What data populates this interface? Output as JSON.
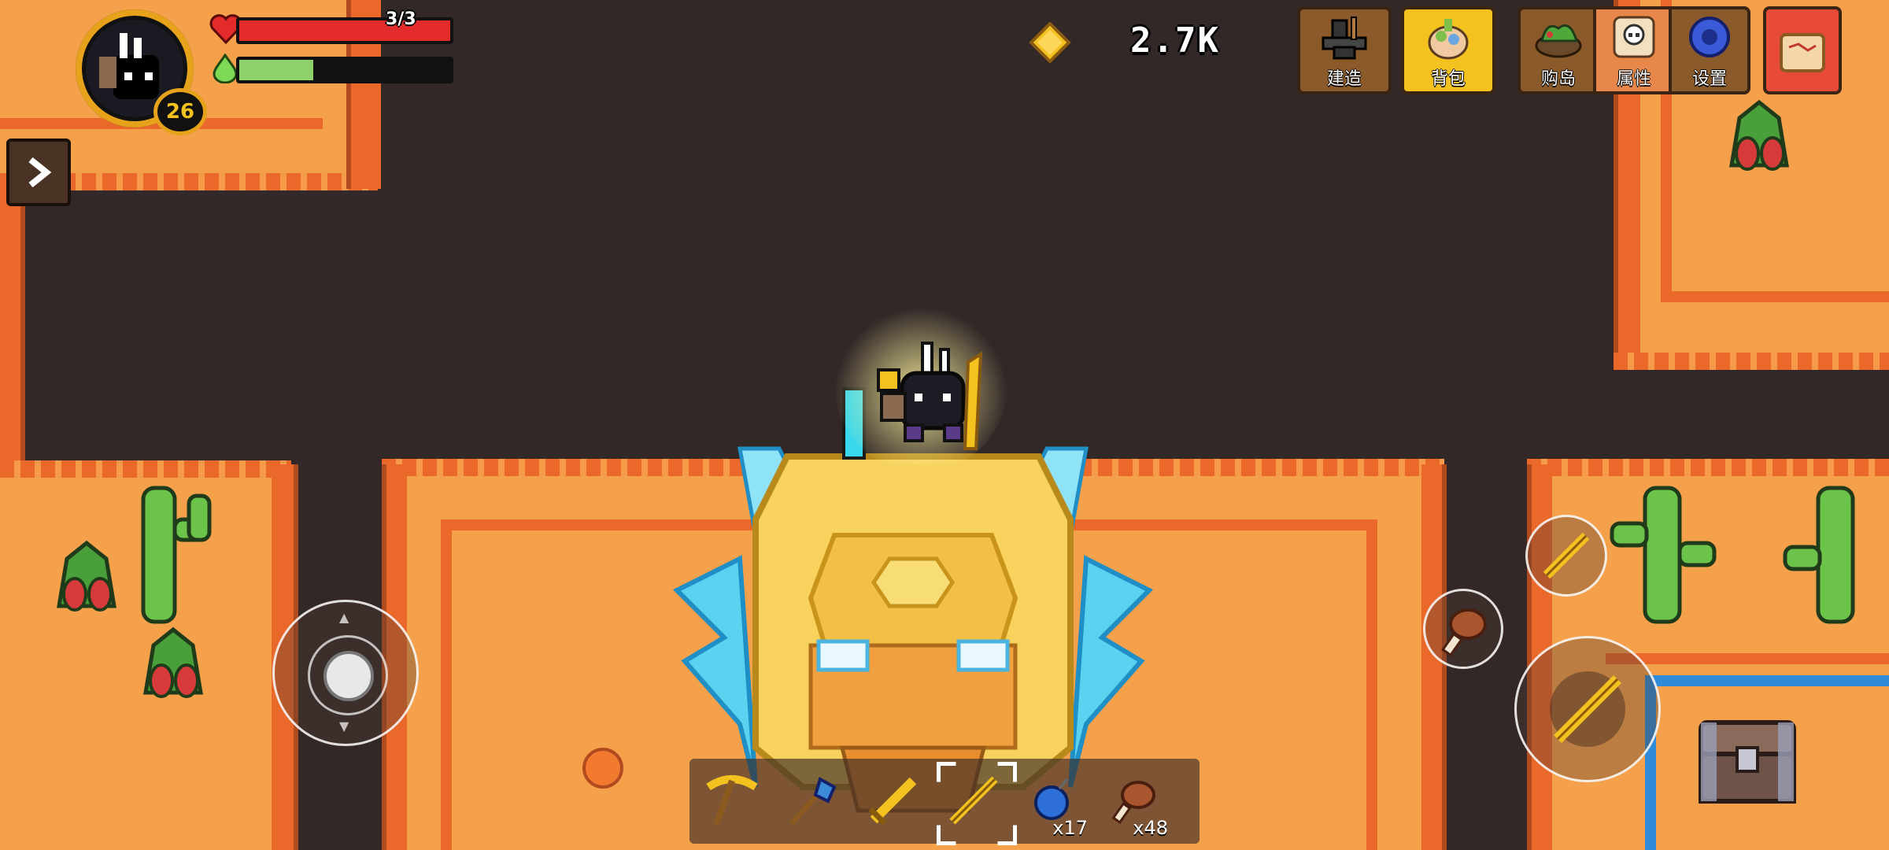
{
  "hud": {
    "health_text": "3/3",
    "health_fraction": 1.0,
    "energy_fraction": 0.35,
    "player_level": "26",
    "currency_amount": "2.7K"
  },
  "menu_buttons": [
    {
      "label": "建造",
      "icon": "anvil-icon"
    },
    {
      "label": "背包",
      "icon": "backpack-icon"
    },
    {
      "label": "购岛",
      "icon": "island-icon"
    },
    {
      "label": "属性",
      "icon": "skull-scroll-icon"
    },
    {
      "label": "设置",
      "icon": "gear-icon"
    },
    {
      "label": "",
      "icon": "map-scroll-icon"
    }
  ],
  "hotbar": [
    {
      "item": "pickaxe-icon",
      "count": ""
    },
    {
      "item": "shovel-icon",
      "count": ""
    },
    {
      "item": "golden-sword-icon",
      "count": ""
    },
    {
      "item": "golden-spear-icon",
      "count": "",
      "selected": true
    },
    {
      "item": "blue-bomb-icon",
      "count": "x17"
    },
    {
      "item": "meat-leg-icon",
      "count": "x48"
    }
  ],
  "colors": {
    "health": "#e32b2b",
    "energy": "#8fd16a",
    "sand": "#f5a04a",
    "wall": "#e9682a",
    "gold": "#f4c21e"
  }
}
